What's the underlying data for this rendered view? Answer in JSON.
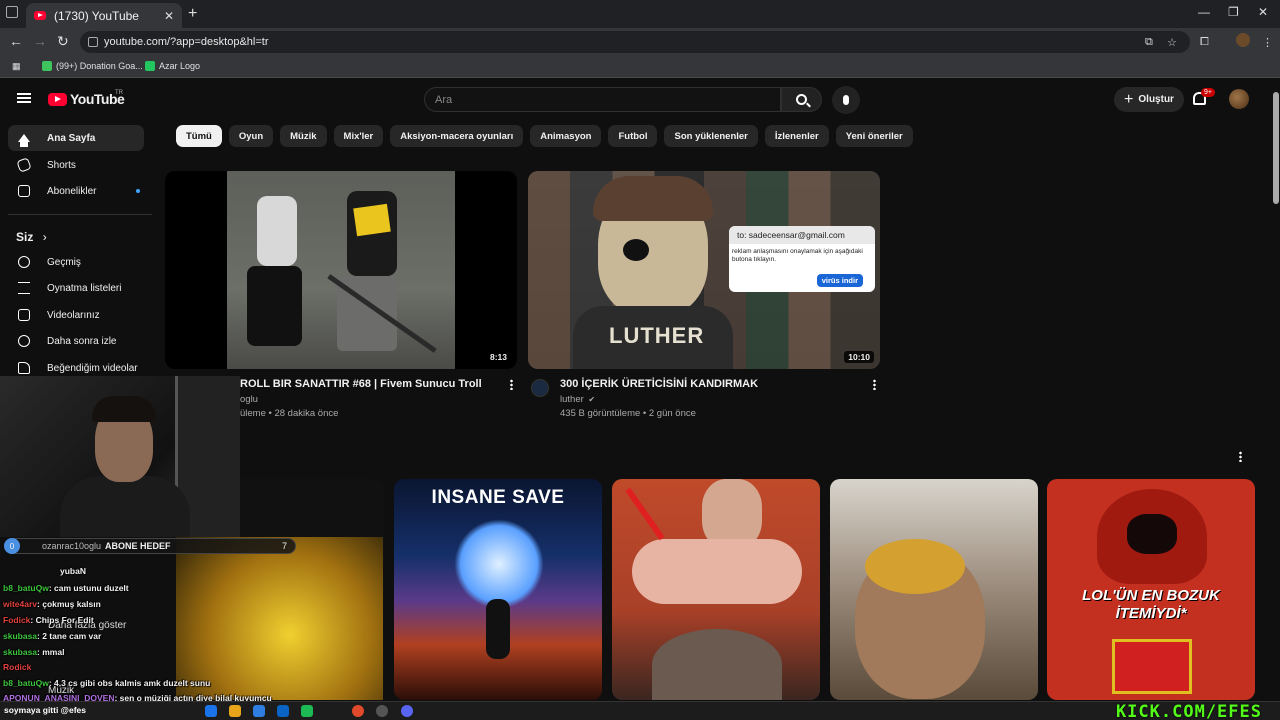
{
  "browser": {
    "tab_title": "(1730) YouTube",
    "tab_close": "✕",
    "new_tab": "+",
    "url": "youtube.com/?app=desktop&hl=tr",
    "window_controls": [
      "—",
      "❐",
      "✕"
    ],
    "bookmarks": [
      {
        "label": "(99+) Donation Goa...",
        "color": "#3ec55e"
      },
      {
        "label": "Azar Logo",
        "color": "#22c55e"
      }
    ]
  },
  "youtube": {
    "logo_text": "YouTube",
    "country": "TR",
    "search_placeholder": "Ara",
    "create_label": "Oluştur",
    "notification_count": "9+"
  },
  "sidebar": {
    "items": [
      {
        "label": "Ana Sayfa",
        "icon": "home-icon"
      },
      {
        "label": "Shorts",
        "icon": "shorts-icon"
      },
      {
        "label": "Abonelikler",
        "icon": "subscriptions-icon"
      }
    ],
    "section_title": "Siz",
    "section_chevron": "›",
    "you_items": [
      {
        "label": "Geçmiş",
        "icon": "history-icon"
      },
      {
        "label": "Oynatma listeleri",
        "icon": "playlists-icon"
      },
      {
        "label": "Videolarınız",
        "icon": "your-videos-icon"
      },
      {
        "label": "Daha sonra izle",
        "icon": "watch-later-icon"
      },
      {
        "label": "Beğendiğim videolar",
        "icon": "liked-icon"
      }
    ]
  },
  "chips": [
    "Tümü",
    "Oyun",
    "Müzik",
    "Mix'ler",
    "Aksiyon-macera oyunları",
    "Animasyon",
    "Futbol",
    "Son yüklenenler",
    "İzlenenler",
    "Yeni öneriler"
  ],
  "videos": [
    {
      "title": "ROLL BIR SANATTIR #68 | Fivem Sunucu Troll",
      "channel": "oglu",
      "meta": "üleme • 28 dakika önce",
      "duration": "8:13"
    },
    {
      "title": "300 İÇERİK ÜRETİCİSİNİ KANDIRMAK",
      "channel": "luther",
      "verified": "✔",
      "meta": "435 B görüntüleme • 2 gün önce",
      "duration": "10:10",
      "thumb_text": "LUTHER",
      "popup": {
        "to": "to: sadeceensar@gmail.com",
        "body": "reklam anlaşmasını onaylamak için aşağıdaki butona tıklayın.",
        "button": "virüs indir"
      }
    }
  ],
  "shorts": [
    {
      "thumb_text": "INSANE SAVE"
    },
    {
      "thumb_text": ""
    },
    {
      "thumb_text": ""
    },
    {
      "thumb_text": "LOL'ÜN EN BOZUK İTEMİYDİ*"
    }
  ],
  "stream_overlay": {
    "goal_count_start": "0",
    "goal_user": "ozanrac10oglu",
    "goal_label": "ABONE HEDEF",
    "goal_count": "7",
    "chat": [
      {
        "user": "",
        "text": "yubaN",
        "color": "green"
      },
      {
        "user": "b8_batuQw",
        "text": ": cam ustunu duzelt",
        "color": "green"
      },
      {
        "user": "wite4arv",
        "text": ": çokmuş kalsın",
        "color": "red"
      },
      {
        "user": "Fodick",
        "text": ": Chips For Edit",
        "color": "red"
      },
      {
        "user": "skubasa",
        "text": ": 2 tane cam var",
        "color": "green"
      },
      {
        "user": "skubasa",
        "text": ": mmal",
        "color": "green"
      },
      {
        "user": "Rodick",
        "text": "",
        "color": "red"
      },
      {
        "user": "b8_batuQw",
        "text": ": 4.3 cs gibi obs kalmis amk duzelt sunu",
        "color": "green"
      },
      {
        "user": "APONUN_ANASINI_DOVEN",
        "text": ": sen o müziği açtın diye bilal kuyumcu",
        "color": "violet"
      }
    ],
    "background_side": [
      "Daha fazla göster",
      "Müzik"
    ]
  },
  "taskbar": {
    "status_text": "soymaya gitti @efes",
    "kick_text": "KICK.COM/EFES"
  }
}
